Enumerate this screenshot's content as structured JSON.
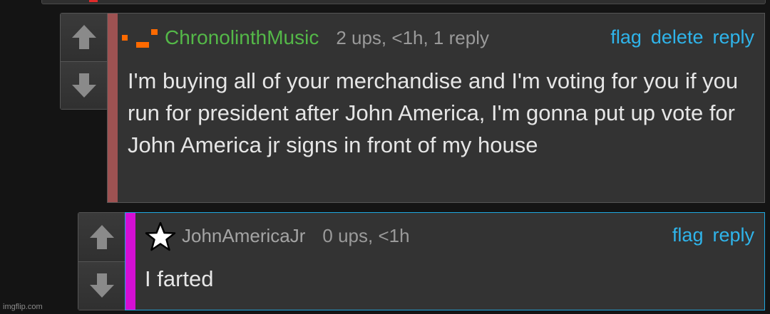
{
  "comments": [
    {
      "username": "ChronolinthMusic",
      "meta": "2 ups, <1h, 1 reply",
      "actions": [
        "flag",
        "delete",
        "reply"
      ],
      "text": "I'm buying all of your merchandise and I'm voting for you if you run for president after John America, I'm gonna put up vote for John America jr signs in front of my house",
      "colors": {
        "username": "#54b848",
        "stripe": "#9e5252",
        "icon": "#ff6a00"
      },
      "icon": "pixel-blocks-icon"
    },
    {
      "username": "JohnAmericaJr",
      "meta": "0 ups, <1h",
      "actions": [
        "flag",
        "reply"
      ],
      "text": "I farted",
      "colors": {
        "username": "#a4a4a4",
        "stripe": "#d40fd4",
        "border": "#1fa8e0"
      },
      "icon": "star-icon"
    }
  ],
  "watermark": "imgflip.com"
}
